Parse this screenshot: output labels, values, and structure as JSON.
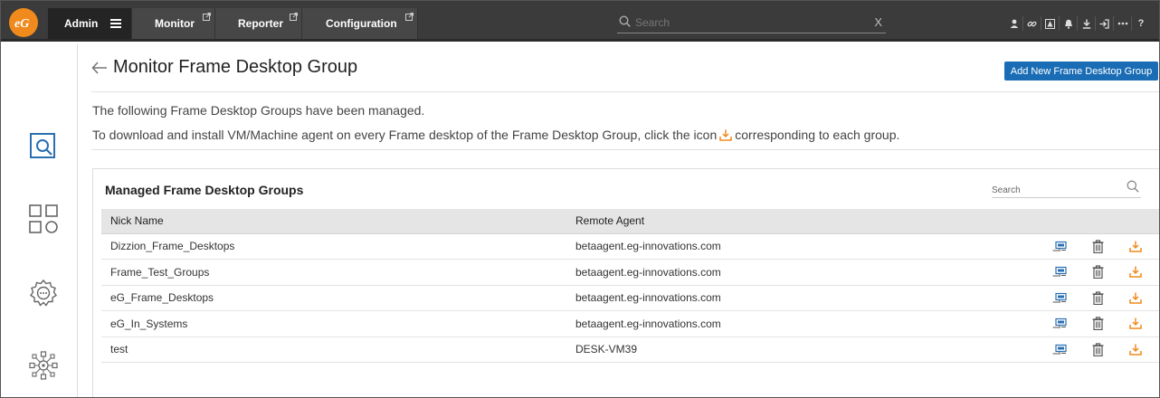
{
  "topbar": {
    "nav": [
      {
        "label": "Admin",
        "active": true
      },
      {
        "label": "Monitor",
        "external": true
      },
      {
        "label": "Reporter",
        "external": true
      },
      {
        "label": "Configuration",
        "external": true
      }
    ],
    "search_placeholder": "Search",
    "clear_label": "X",
    "tools": [
      "user-icon",
      "link-icon",
      "tree-icon",
      "bell-icon",
      "download-icon",
      "sign-in-icon",
      "more-icon",
      "help-icon"
    ]
  },
  "sidebar": {
    "items": [
      "monitor-search-icon",
      "components-icon",
      "settings-icon",
      "network-icon"
    ]
  },
  "page": {
    "title": "Monitor Frame Desktop Group",
    "add_button": "Add New Frame Desktop Group",
    "desc1": "The following Frame Desktop Groups have been managed.",
    "desc2_before": "To download and install VM/Machine agent on every Frame desktop of the Frame Desktop Group, click the icon",
    "desc2_after": "corresponding to each group."
  },
  "panel": {
    "title": "Managed Frame Desktop Groups",
    "search_placeholder": "Search",
    "columns": [
      "Nick Name",
      "Remote Agent"
    ],
    "rows": [
      {
        "nick": "Dizzion_Frame_Desktops",
        "agent": "betaagent.eg-innovations.com"
      },
      {
        "nick": "Frame_Test_Groups",
        "agent": "betaagent.eg-innovations.com"
      },
      {
        "nick": "eG_Frame_Desktops",
        "agent": "betaagent.eg-innovations.com"
      },
      {
        "nick": "eG_In_Systems",
        "agent": "betaagent.eg-innovations.com"
      },
      {
        "nick": "test",
        "agent": "DESK-VM39"
      }
    ]
  },
  "colors": {
    "topbar": "#3b3b3b",
    "accent_blue": "#1a6db5",
    "brand_orange": "#f08a1c",
    "sidebar_icon": "#2a6fb0"
  }
}
